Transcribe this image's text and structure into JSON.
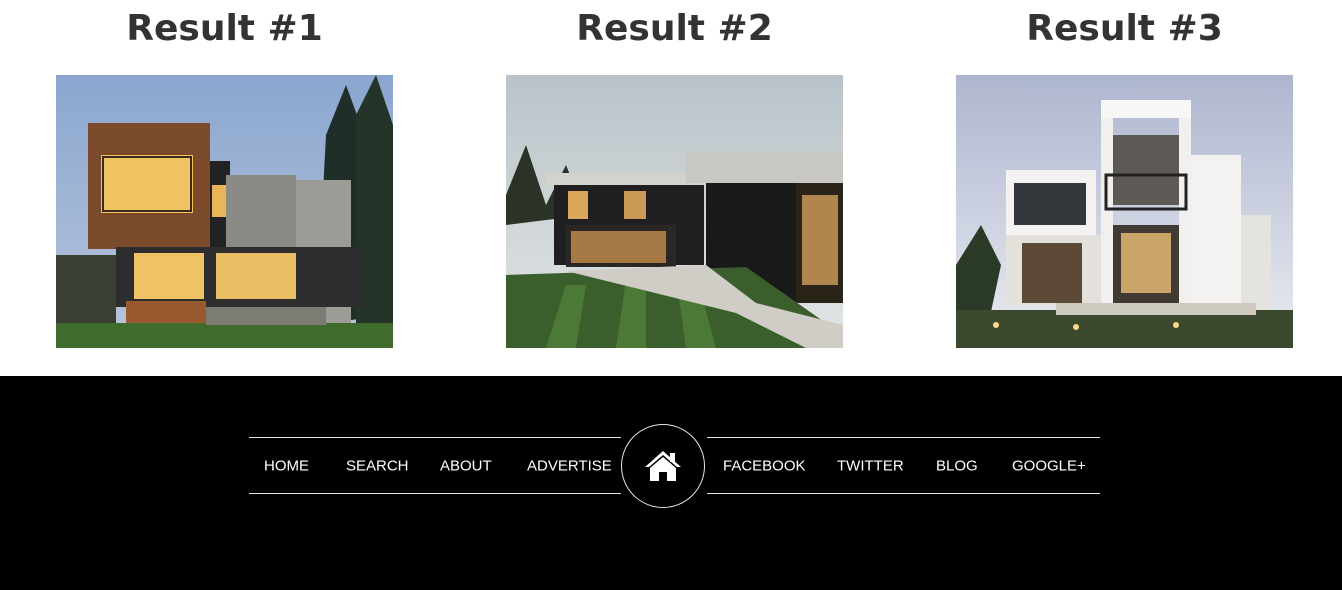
{
  "results": [
    {
      "title": "Result #1",
      "image": "modern-house-wood-clad-photo"
    },
    {
      "title": "Result #2",
      "image": "modern-house-dark-striped-lawn-photo"
    },
    {
      "title": "Result #3",
      "image": "modern-house-white-balconies-photo"
    }
  ],
  "footer": {
    "nav_left": [
      "HOME",
      "SEARCH",
      "ABOUT",
      "ADVERTISE"
    ],
    "nav_right": [
      "FACEBOOK",
      "TWITTER",
      "BLOG",
      "GOOGLE+"
    ],
    "center_icon": "home-icon"
  },
  "colors": {
    "page_background": "#ffffff",
    "heading_text": "#333333",
    "footer_background": "#000000",
    "footer_text": "#ffffff",
    "footer_rule": "#e6e6e6"
  }
}
